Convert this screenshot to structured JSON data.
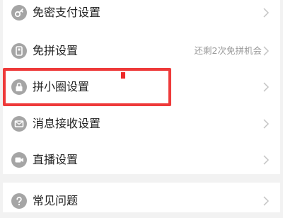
{
  "settings": {
    "items": [
      {
        "label": "免密支付设置",
        "hint": "",
        "icon": "key-icon"
      },
      {
        "label": "免拼设置",
        "hint": "还剩2次免拼机会",
        "icon": "phone-icon"
      },
      {
        "label": "拼小圈设置",
        "hint": "",
        "icon": "lock-icon"
      },
      {
        "label": "消息接收设置",
        "hint": "",
        "icon": "mail-icon"
      },
      {
        "label": "直播设置",
        "hint": "",
        "icon": "video-icon"
      }
    ]
  },
  "help": {
    "items": [
      {
        "label": "常见问题",
        "hint": "",
        "icon": "question-icon"
      }
    ]
  },
  "colors": {
    "icon_gray": "#a5a5a5",
    "highlight_red": "#ee3a3a",
    "background": "#f2f2f2"
  }
}
